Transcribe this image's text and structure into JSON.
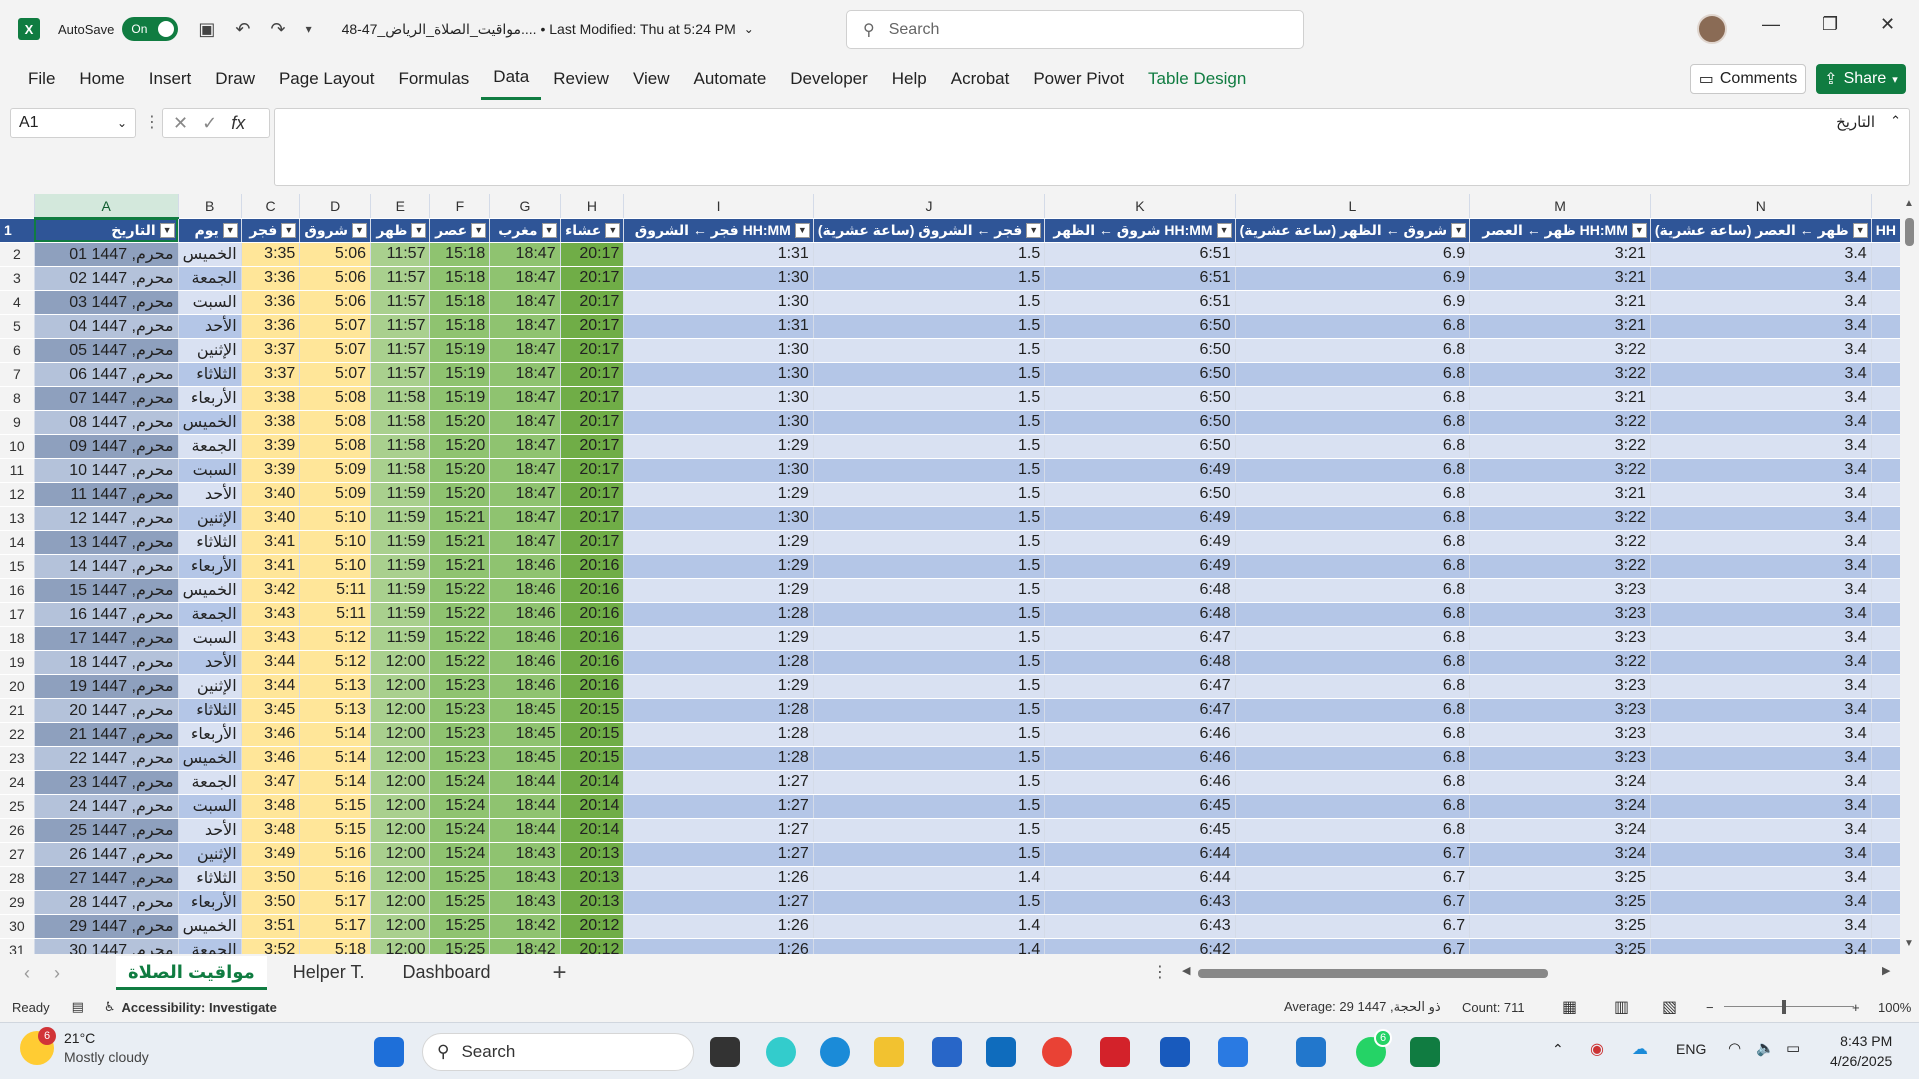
{
  "titlebar": {
    "app_icon": "X",
    "autosave_label": "AutoSave",
    "autosave_state": "On",
    "doc_title": "48-47_مواقيت_الصلاة_الرياض....  •  Last Modified: Thu at 5:24 PM",
    "search_placeholder": "Search"
  },
  "menu": {
    "items": [
      "File",
      "Home",
      "Insert",
      "Draw",
      "Page Layout",
      "Formulas",
      "Data",
      "Review",
      "View",
      "Automate",
      "Developer",
      "Help",
      "Acrobat",
      "Power Pivot",
      "Table Design"
    ],
    "comments": "Comments",
    "share": "Share"
  },
  "formula_bar": {
    "name_box": "A1",
    "fx": "fx",
    "content": "التاريخ"
  },
  "columns": [
    "A",
    "B",
    "C",
    "D",
    "E",
    "F",
    "G",
    "H",
    "I",
    "J",
    "K",
    "L",
    "M",
    "N"
  ],
  "headers": [
    "التاريخ",
    "يوم",
    "فجر",
    "شروق",
    "ظهر",
    "عصر",
    "مغرب",
    "عشاء",
    "فجر ← الشروق HH:MM",
    "فجر ← الشروق (ساعة عشرية)",
    "شروق ← الظهر HH:MM",
    "شروق ← الظهر (ساعة عشرية)",
    "ظهر ← العصر HH:MM",
    "ظهر ← العصر (ساعة عشرية)",
    "HH"
  ],
  "rows": [
    [
      "01 محرم, 1447",
      "الخميس",
      "3:35",
      "5:06",
      "11:57",
      "15:18",
      "18:47",
      "20:17",
      "1:31",
      "1.5",
      "6:51",
      "6.9",
      "3:21",
      "3.4"
    ],
    [
      "02 محرم, 1447",
      "الجمعة",
      "3:36",
      "5:06",
      "11:57",
      "15:18",
      "18:47",
      "20:17",
      "1:30",
      "1.5",
      "6:51",
      "6.9",
      "3:21",
      "3.4"
    ],
    [
      "03 محرم, 1447",
      "السبت",
      "3:36",
      "5:06",
      "11:57",
      "15:18",
      "18:47",
      "20:17",
      "1:30",
      "1.5",
      "6:51",
      "6.9",
      "3:21",
      "3.4"
    ],
    [
      "04 محرم, 1447",
      "الأحد",
      "3:36",
      "5:07",
      "11:57",
      "15:18",
      "18:47",
      "20:17",
      "1:31",
      "1.5",
      "6:50",
      "6.8",
      "3:21",
      "3.4"
    ],
    [
      "05 محرم, 1447",
      "الإثنين",
      "3:37",
      "5:07",
      "11:57",
      "15:19",
      "18:47",
      "20:17",
      "1:30",
      "1.5",
      "6:50",
      "6.8",
      "3:22",
      "3.4"
    ],
    [
      "06 محرم, 1447",
      "الثلاثاء",
      "3:37",
      "5:07",
      "11:57",
      "15:19",
      "18:47",
      "20:17",
      "1:30",
      "1.5",
      "6:50",
      "6.8",
      "3:22",
      "3.4"
    ],
    [
      "07 محرم, 1447",
      "الأربعاء",
      "3:38",
      "5:08",
      "11:58",
      "15:19",
      "18:47",
      "20:17",
      "1:30",
      "1.5",
      "6:50",
      "6.8",
      "3:21",
      "3.4"
    ],
    [
      "08 محرم, 1447",
      "الخميس",
      "3:38",
      "5:08",
      "11:58",
      "15:20",
      "18:47",
      "20:17",
      "1:30",
      "1.5",
      "6:50",
      "6.8",
      "3:22",
      "3.4"
    ],
    [
      "09 محرم, 1447",
      "الجمعة",
      "3:39",
      "5:08",
      "11:58",
      "15:20",
      "18:47",
      "20:17",
      "1:29",
      "1.5",
      "6:50",
      "6.8",
      "3:22",
      "3.4"
    ],
    [
      "10 محرم, 1447",
      "السبت",
      "3:39",
      "5:09",
      "11:58",
      "15:20",
      "18:47",
      "20:17",
      "1:30",
      "1.5",
      "6:49",
      "6.8",
      "3:22",
      "3.4"
    ],
    [
      "11 محرم, 1447",
      "الأحد",
      "3:40",
      "5:09",
      "11:59",
      "15:20",
      "18:47",
      "20:17",
      "1:29",
      "1.5",
      "6:50",
      "6.8",
      "3:21",
      "3.4"
    ],
    [
      "12 محرم, 1447",
      "الإثنين",
      "3:40",
      "5:10",
      "11:59",
      "15:21",
      "18:47",
      "20:17",
      "1:30",
      "1.5",
      "6:49",
      "6.8",
      "3:22",
      "3.4"
    ],
    [
      "13 محرم, 1447",
      "الثلاثاء",
      "3:41",
      "5:10",
      "11:59",
      "15:21",
      "18:47",
      "20:17",
      "1:29",
      "1.5",
      "6:49",
      "6.8",
      "3:22",
      "3.4"
    ],
    [
      "14 محرم, 1447",
      "الأربعاء",
      "3:41",
      "5:10",
      "11:59",
      "15:21",
      "18:46",
      "20:16",
      "1:29",
      "1.5",
      "6:49",
      "6.8",
      "3:22",
      "3.4"
    ],
    [
      "15 محرم, 1447",
      "الخميس",
      "3:42",
      "5:11",
      "11:59",
      "15:22",
      "18:46",
      "20:16",
      "1:29",
      "1.5",
      "6:48",
      "6.8",
      "3:23",
      "3.4"
    ],
    [
      "16 محرم, 1447",
      "الجمعة",
      "3:43",
      "5:11",
      "11:59",
      "15:22",
      "18:46",
      "20:16",
      "1:28",
      "1.5",
      "6:48",
      "6.8",
      "3:23",
      "3.4"
    ],
    [
      "17 محرم, 1447",
      "السبت",
      "3:43",
      "5:12",
      "11:59",
      "15:22",
      "18:46",
      "20:16",
      "1:29",
      "1.5",
      "6:47",
      "6.8",
      "3:23",
      "3.4"
    ],
    [
      "18 محرم, 1447",
      "الأحد",
      "3:44",
      "5:12",
      "12:00",
      "15:22",
      "18:46",
      "20:16",
      "1:28",
      "1.5",
      "6:48",
      "6.8",
      "3:22",
      "3.4"
    ],
    [
      "19 محرم, 1447",
      "الإثنين",
      "3:44",
      "5:13",
      "12:00",
      "15:23",
      "18:46",
      "20:16",
      "1:29",
      "1.5",
      "6:47",
      "6.8",
      "3:23",
      "3.4"
    ],
    [
      "20 محرم, 1447",
      "الثلاثاء",
      "3:45",
      "5:13",
      "12:00",
      "15:23",
      "18:45",
      "20:15",
      "1:28",
      "1.5",
      "6:47",
      "6.8",
      "3:23",
      "3.4"
    ],
    [
      "21 محرم, 1447",
      "الأربعاء",
      "3:46",
      "5:14",
      "12:00",
      "15:23",
      "18:45",
      "20:15",
      "1:28",
      "1.5",
      "6:46",
      "6.8",
      "3:23",
      "3.4"
    ],
    [
      "22 محرم, 1447",
      "الخميس",
      "3:46",
      "5:14",
      "12:00",
      "15:23",
      "18:45",
      "20:15",
      "1:28",
      "1.5",
      "6:46",
      "6.8",
      "3:23",
      "3.4"
    ],
    [
      "23 محرم, 1447",
      "الجمعة",
      "3:47",
      "5:14",
      "12:00",
      "15:24",
      "18:44",
      "20:14",
      "1:27",
      "1.5",
      "6:46",
      "6.8",
      "3:24",
      "3.4"
    ],
    [
      "24 محرم, 1447",
      "السبت",
      "3:48",
      "5:15",
      "12:00",
      "15:24",
      "18:44",
      "20:14",
      "1:27",
      "1.5",
      "6:45",
      "6.8",
      "3:24",
      "3.4"
    ],
    [
      "25 محرم, 1447",
      "الأحد",
      "3:48",
      "5:15",
      "12:00",
      "15:24",
      "18:44",
      "20:14",
      "1:27",
      "1.5",
      "6:45",
      "6.8",
      "3:24",
      "3.4"
    ],
    [
      "26 محرم, 1447",
      "الإثنين",
      "3:49",
      "5:16",
      "12:00",
      "15:24",
      "18:43",
      "20:13",
      "1:27",
      "1.5",
      "6:44",
      "6.7",
      "3:24",
      "3.4"
    ],
    [
      "27 محرم, 1447",
      "الثلاثاء",
      "3:50",
      "5:16",
      "12:00",
      "15:25",
      "18:43",
      "20:13",
      "1:26",
      "1.4",
      "6:44",
      "6.7",
      "3:25",
      "3.4"
    ],
    [
      "28 محرم, 1447",
      "الأربعاء",
      "3:50",
      "5:17",
      "12:00",
      "15:25",
      "18:43",
      "20:13",
      "1:27",
      "1.5",
      "6:43",
      "6.7",
      "3:25",
      "3.4"
    ],
    [
      "29 محرم, 1447",
      "الخميس",
      "3:51",
      "5:17",
      "12:00",
      "15:25",
      "18:42",
      "20:12",
      "1:26",
      "1.4",
      "6:43",
      "6.7",
      "3:25",
      "3.4"
    ],
    [
      "30 محرم, 1447",
      "الجمعة",
      "3:52",
      "5:18",
      "12:00",
      "15:25",
      "18:42",
      "20:12",
      "1:26",
      "1.4",
      "6:42",
      "6.7",
      "3:25",
      "3.4"
    ]
  ],
  "sheets": {
    "tabs": [
      "مواقيت الصلاة",
      "Helper T.",
      "Dashboard"
    ],
    "add": "+"
  },
  "status": {
    "ready": "Ready",
    "accessibility": "Accessibility: Investigate",
    "average": "Average: 29 ذو الحجة, 1447",
    "count": "Count: 711",
    "zoom": "100%"
  },
  "taskbar": {
    "weather_temp": "21°C",
    "weather_desc": "Mostly cloudy",
    "weather_badge": "6",
    "search": "Search",
    "lang": "ENG",
    "time": "8:43 PM",
    "date": "4/26/2025",
    "whatsapp_badge": "6"
  }
}
